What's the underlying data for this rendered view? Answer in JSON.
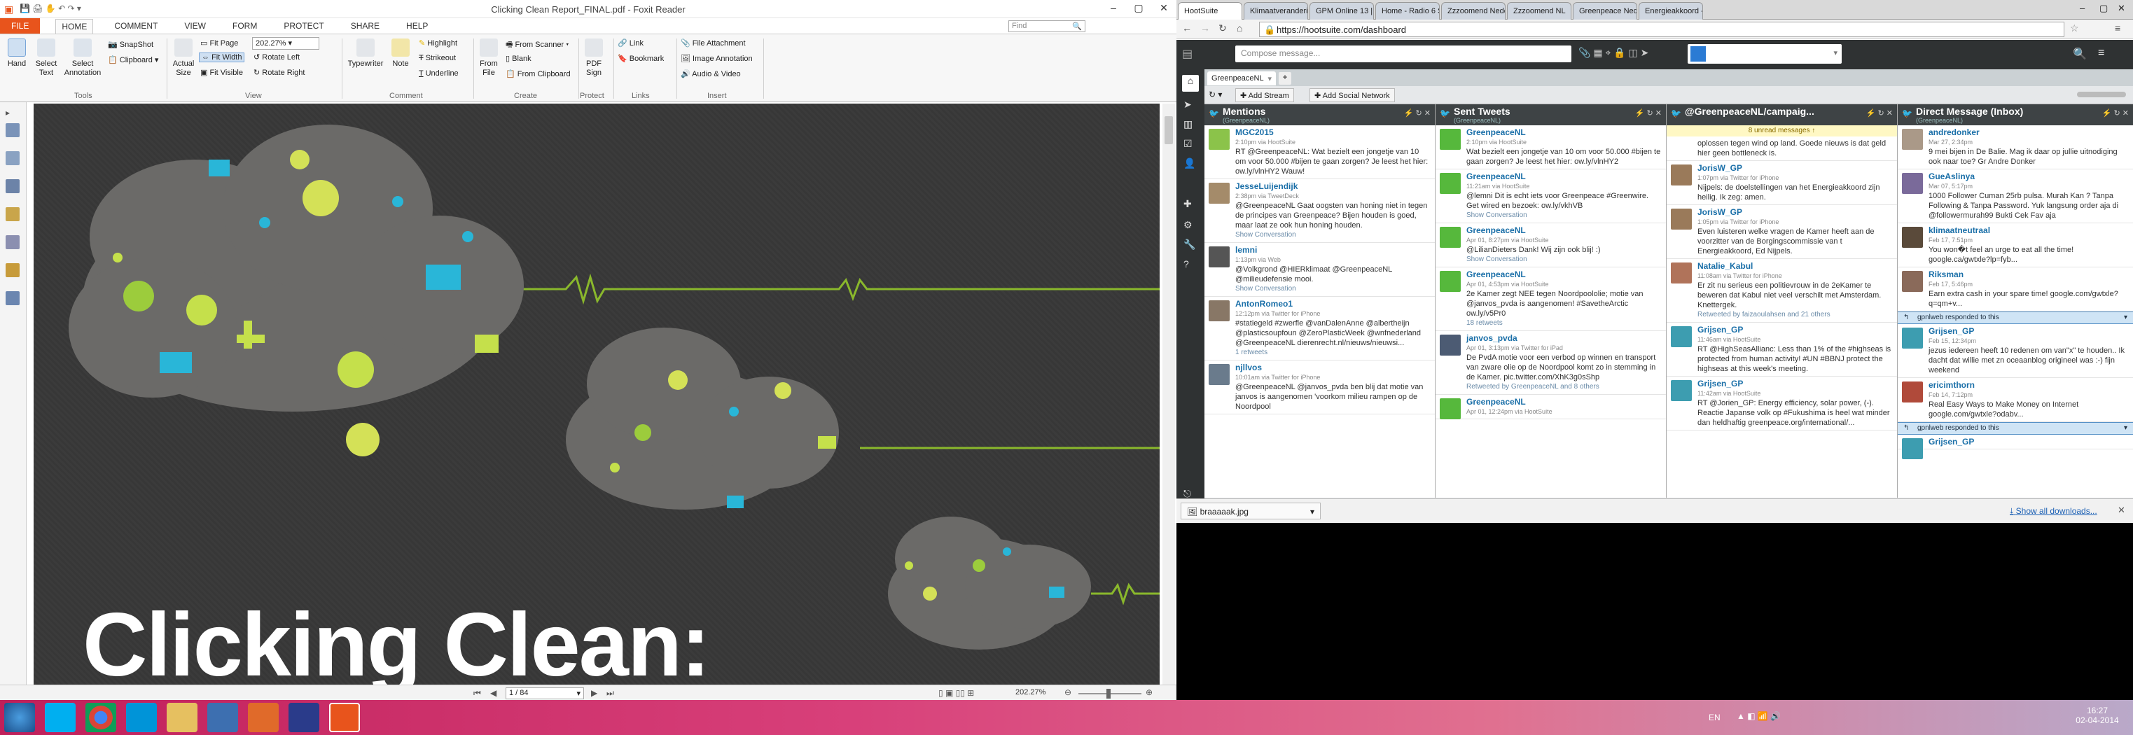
{
  "foxit": {
    "title": "Clicking Clean Report_FINAL.pdf - Foxit Reader",
    "menu": [
      "FILE",
      "HOME",
      "COMMENT",
      "VIEW",
      "FORM",
      "PROTECT",
      "SHARE",
      "HELP"
    ],
    "find_placeholder": "Find",
    "ribbon": {
      "hand": "Hand",
      "select_text": "Select\nText",
      "select_annotation": "Select\nAnnotation",
      "snapshot": "SnapShot",
      "clipboard": "Clipboard",
      "actual_size": "Actual\nSize",
      "fit_page": "Fit Page",
      "fit_width": "Fit Width",
      "fit_visible": "Fit Visible",
      "zoom": "202.27%",
      "rotate_left": "Rotate Left",
      "rotate_right": "Rotate Right",
      "typewriter": "Typewriter",
      "note": "Note",
      "highlight": "Highlight",
      "strikeout": "Strikeout",
      "underline": "Underline",
      "from_file": "From\nFile",
      "from_scanner": "From Scanner",
      "blank": "Blank",
      "from_clipboard": "From Clipboard",
      "pdf_sign": "PDF\nSign",
      "link": "Link",
      "bookmark": "Bookmark",
      "file_attachment": "File Attachment",
      "image_annotation": "Image Annotation",
      "audio_video": "Audio & Video",
      "groups": [
        "Tools",
        "View",
        "Comment",
        "Create",
        "Protect",
        "Links",
        "Insert"
      ]
    },
    "doc_headline": "Clicking Clean:",
    "status": {
      "page": "1 / 84",
      "zoom": "202.27%"
    }
  },
  "chrome": {
    "tabs": [
      "HootSuite",
      "Klimaatverandering...",
      "GPM Online 13 | ...",
      "Home - Radio 6 S...",
      "Zzzoomend Nede...",
      "Zzzoomend NL",
      "Greenpeace Nede...",
      "Energieakkoord -"
    ],
    "url": "https://hootsuite.com/dashboard",
    "download_file": "braaaaak.jpg",
    "show_all_downloads": "Show all downloads..."
  },
  "hootsuite": {
    "compose_placeholder": "Compose message...",
    "tab_name": "GreenpeaceNL",
    "add_stream": "Add Stream",
    "add_social_network": "Add Social Network",
    "columns": [
      {
        "title": "Mentions",
        "sub": "(GreenpeaceNL)",
        "posts": [
          {
            "name": "MGC2015",
            "meta": "2:10pm via HootSuite",
            "text": "RT @GreenpeaceNL: Wat bezielt een jongetje van 10 om voor 50.000 #bijen te gaan zorgen? Je leest het hier: ow.ly/vlnHY2 Wauw!",
            "extra": ""
          },
          {
            "name": "JesseLuijendijk",
            "meta": "2:38pm via TweetDeck",
            "text": "@GreenpeaceNL Gaat oogsten van honing niet in tegen de principes van Greenpeace? Bijen houden is goed, maar laat ze ook hun honing houden.",
            "extra": "Show Conversation"
          },
          {
            "name": "lemni",
            "meta": "1:13pm via Web",
            "text": "@Volkgrond @HIERklimaat @GreenpeaceNL @milieudefensie mooi.",
            "extra": "Show Conversation"
          },
          {
            "name": "AntonRomeo1",
            "meta": "12:12pm via Twitter for iPhone",
            "text": "#statiegeld #zwerfle @vanDalenAnne @albertheijn @plasticsoupfoun @ZeroPlasticWeek @wnfnederland @GreenpeaceNL dierenrecht.nl/nieuws/nieuwsi...",
            "extra": "1 retweets"
          },
          {
            "name": "njllvos",
            "meta": "10:01am via Twitter for iPhone",
            "text": "@GreenpeaceNL @janvos_pvda ben blij dat motie van janvos is aangenomen 'voorkom milieu rampen op de Noordpool",
            "extra": ""
          }
        ]
      },
      {
        "title": "Sent Tweets",
        "sub": "(GreenpeaceNL)",
        "posts": [
          {
            "name": "GreenpeaceNL",
            "meta": "2:10pm via HootSuite",
            "text": "Wat bezielt een jongetje van 10 om voor 50.000 #bijen te gaan zorgen? Je leest het hier: ow.ly/vlnHY2",
            "extra": ""
          },
          {
            "name": "GreenpeaceNL",
            "meta": "11:21am via HootSuite",
            "text": "@lemni Dit is echt iets voor Greenpeace #Greenwire. Get wired en bezoek: ow.ly/vkhVB",
            "extra": "Show Conversation"
          },
          {
            "name": "GreenpeaceNL",
            "meta": "Apr 01, 8:27pm via HootSuite",
            "text": "@LilianDieters Dank! Wij zijn ook blij! :)",
            "extra": "Show Conversation"
          },
          {
            "name": "GreenpeaceNL",
            "meta": "Apr 01, 4:53pm via HootSuite",
            "text": "2e Kamer zegt NEE tegen Noordpoololie; motie van @janvos_pvda is aangenomen! #SavetheArctic ow.ly/v5Pr0",
            "extra": "18 retweets"
          },
          {
            "name": "janvos_pvda",
            "meta": "Apr 01, 3:13pm via Twitter for iPad",
            "text": "De PvdA motie voor een verbod op winnen en transport van zware olie op de Noordpool komt zo in stemming in de Kamer. pic.twitter.com/XhK3g0sShp",
            "extra": "Retweeted by GreenpeaceNL and 8 others"
          },
          {
            "name": "GreenpeaceNL",
            "meta": "Apr 01, 12:24pm via HootSuite",
            "text": "",
            "extra": ""
          }
        ]
      },
      {
        "title": "@GreenpeaceNL/campaig...",
        "sub": "",
        "banner": "8 unread messages",
        "posts": [
          {
            "name": "",
            "meta": "",
            "text": "oplossen tegen wind op land. Goede nieuws is dat geld hier geen bottleneck is.",
            "extra": ""
          },
          {
            "name": "JorisW_GP",
            "meta": "1:07pm via Twitter for iPhone",
            "text": "Nijpels: de doelstellingen van het Energieakkoord zijn heilig. Ik zeg: amen.",
            "extra": ""
          },
          {
            "name": "JorisW_GP",
            "meta": "1:05pm via Twitter for iPhone",
            "text": "Even luisteren welke vragen de Kamer heeft aan de voorzitter van de Borgingscommissie van t Energieakkoord, Ed Nijpels.",
            "extra": ""
          },
          {
            "name": "Natalie_Kabul",
            "meta": "11:08am via Twitter for iPhone",
            "text": "Er zit nu serieus een politievrouw in de 2eKamer te beweren dat Kabul niet veel verschilt met Amsterdam. Knettergek.",
            "extra": "Retweeted by faizaoulahsen and 21 others"
          },
          {
            "name": "Grijsen_GP",
            "meta": "11:46am via HootSuite",
            "text": "RT @HighSeasAllianc: Less than 1% of the #highseas is protected from human activity! #UN #BBNJ protect the highseas at this week's meeting.",
            "extra": ""
          },
          {
            "name": "Grijsen_GP",
            "meta": "11:42am via HootSuite",
            "text": "RT @Jorien_GP: Energy efficiency, solar power, (-). Reactie Japanse volk op #Fukushima is heel wat minder dan heldhaftig greenpeace.org/international/...",
            "extra": ""
          }
        ]
      },
      {
        "title": "Direct Message (Inbox)",
        "sub": "(GreenpeaceNL)",
        "posts": [
          {
            "name": "andredonker",
            "meta": "Mar 27, 2:34pm",
            "text": "9 mei bijen in De Balie. Mag ik daar op jullie uitnodiging ook naar toe? Gr Andre Donker",
            "extra": ""
          },
          {
            "name": "GueAslinya",
            "meta": "Mar 07, 5:17pm",
            "text": "1000 Follower Cuman 25rb pulsa. Murah Kan ? Tanpa Following & Tanpa Password. Yuk langsung order aja di @followermurah99 Bukti Cek Fav aja",
            "extra": ""
          },
          {
            "name": "klimaatneutraal",
            "meta": "Feb 17, 7:51pm",
            "text": "You won�t feel an urge to eat all the time! google.ca/gwtxle?lp=fyb...",
            "extra": ""
          },
          {
            "name": "Riksman",
            "meta": "Feb 17, 5:46pm",
            "text": "Earn extra cash in your spare time! google.com/gwtxle?q=qm+v...",
            "extra": ""
          },
          {
            "name": "Grijsen_GP",
            "meta": "Feb 15, 12:34pm",
            "text": "jezus iedereen heeft 10 redenen om van\"x\" te houden.. Ik dacht dat willie met zn oceaanblog origineel was :-) fijn weekend",
            "extra": "",
            "notice": "gpnlweb responded to this"
          },
          {
            "name": "ericimthorn",
            "meta": "Feb 14, 7:12pm",
            "text": "Real Easy Ways to Make Money on Internet google.com/gwtxle?odabv...",
            "extra": ""
          },
          {
            "name": "Grijsen_GP",
            "meta": "",
            "text": "",
            "extra": "",
            "notice": "gpnlweb responded to this"
          }
        ]
      }
    ]
  },
  "taskbar": {
    "lang": "EN",
    "time": "16:27",
    "date": "02-04-2014"
  },
  "colors": {
    "foxit_accent": "#e8541c",
    "hootsuite_dark": "#2f3233",
    "twitter_blue": "#1a6fa8",
    "taskbar": "#c0205a"
  }
}
